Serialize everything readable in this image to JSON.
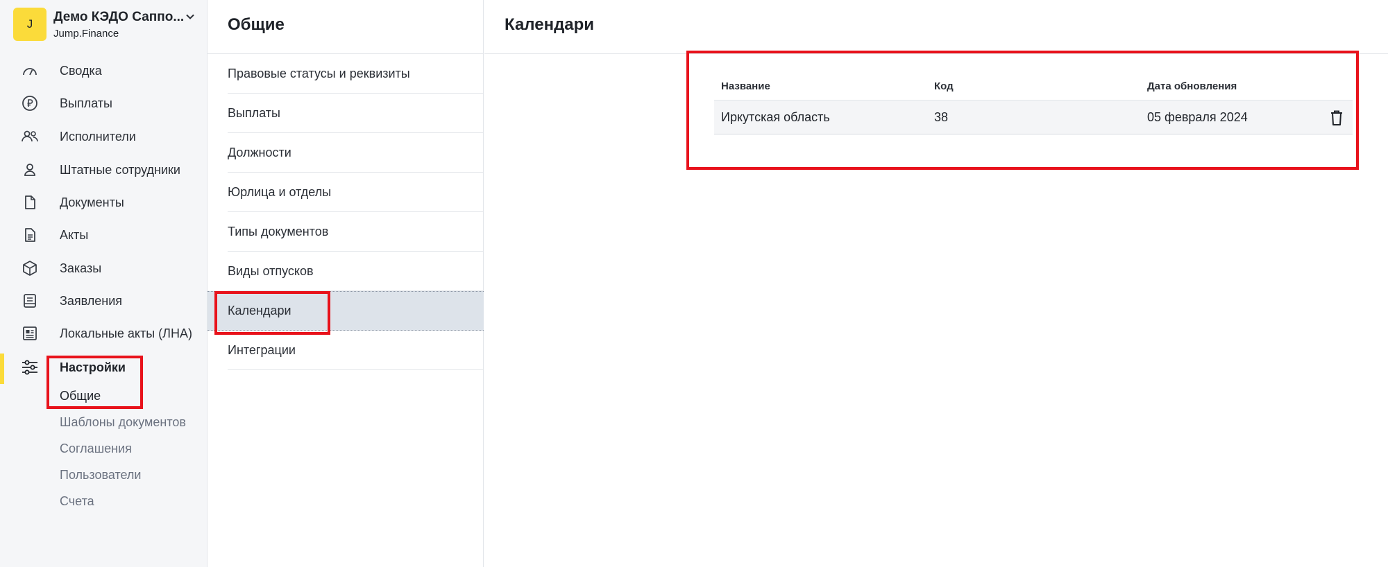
{
  "org": {
    "avatar_letter": "J",
    "name": "Демо КЭДО Саппо...",
    "subtitle": "Jump.Finance"
  },
  "sidebar": {
    "items": [
      {
        "label": "Сводка",
        "icon": "gauge-icon"
      },
      {
        "label": "Выплаты",
        "icon": "ruble-icon"
      },
      {
        "label": "Исполнители",
        "icon": "people-icon"
      },
      {
        "label": "Штатные сотрудники",
        "icon": "person-icon"
      },
      {
        "label": "Документы",
        "icon": "document-icon"
      },
      {
        "label": "Акты",
        "icon": "act-icon"
      },
      {
        "label": "Заказы",
        "icon": "box-icon"
      },
      {
        "label": "Заявления",
        "icon": "application-icon"
      },
      {
        "label": "Локальные акты (ЛНА)",
        "icon": "newspaper-icon"
      },
      {
        "label": "Настройки",
        "icon": "sliders-icon",
        "active": true
      }
    ],
    "settings_subitems": [
      "Общие",
      "Шаблоны документов",
      "Соглашения",
      "Пользователи",
      "Счета"
    ]
  },
  "middle": {
    "title": "Общие",
    "items": [
      "Правовые статусы и реквизиты",
      "Выплаты",
      "Должности",
      "Юрлица и отделы",
      "Типы документов",
      "Виды отпусков",
      "Календари",
      "Интеграции"
    ],
    "selected": "Календари"
  },
  "main": {
    "title": "Календари",
    "table": {
      "columns": [
        "Название",
        "Код",
        "Дата обновления"
      ],
      "rows": [
        {
          "name": "Иркутская область",
          "code": "38",
          "updated": "05 февраля 2024"
        }
      ]
    }
  },
  "colors": {
    "accent_yellow": "#fbdb3a",
    "annotation_red": "#e8121b",
    "selected_bg": "#dde3ea",
    "sidebar_bg": "#f5f6f8"
  }
}
